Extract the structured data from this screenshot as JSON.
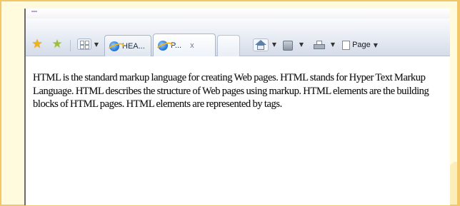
{
  "window": {
    "accent": "#f2c76a",
    "background": "#fffbdc"
  },
  "toolbar": {
    "favorites_icon": "favorites-star-icon",
    "add_favorites_icon": "add-to-favorites-icon",
    "quick_tabs_icon": "quick-tabs-grid-icon",
    "tabs": [
      {
        "label": "HEA...",
        "icon": "internet-explorer-icon"
      },
      {
        "label": "P...",
        "icon": "internet-explorer-icon",
        "close": "x"
      }
    ],
    "home_icon": "home-icon",
    "feeds_icon": "feeds-icon",
    "print_icon": "print-icon",
    "page_label": "Page"
  },
  "content": {
    "text": "HTML is the standard markup language for creating Web pages. HTML stands for Hyper Text Markup Language. HTML describes the structure of Web pages using markup. HTML elements are the building blocks of HTML pages. HTML elements are represented by tags."
  }
}
